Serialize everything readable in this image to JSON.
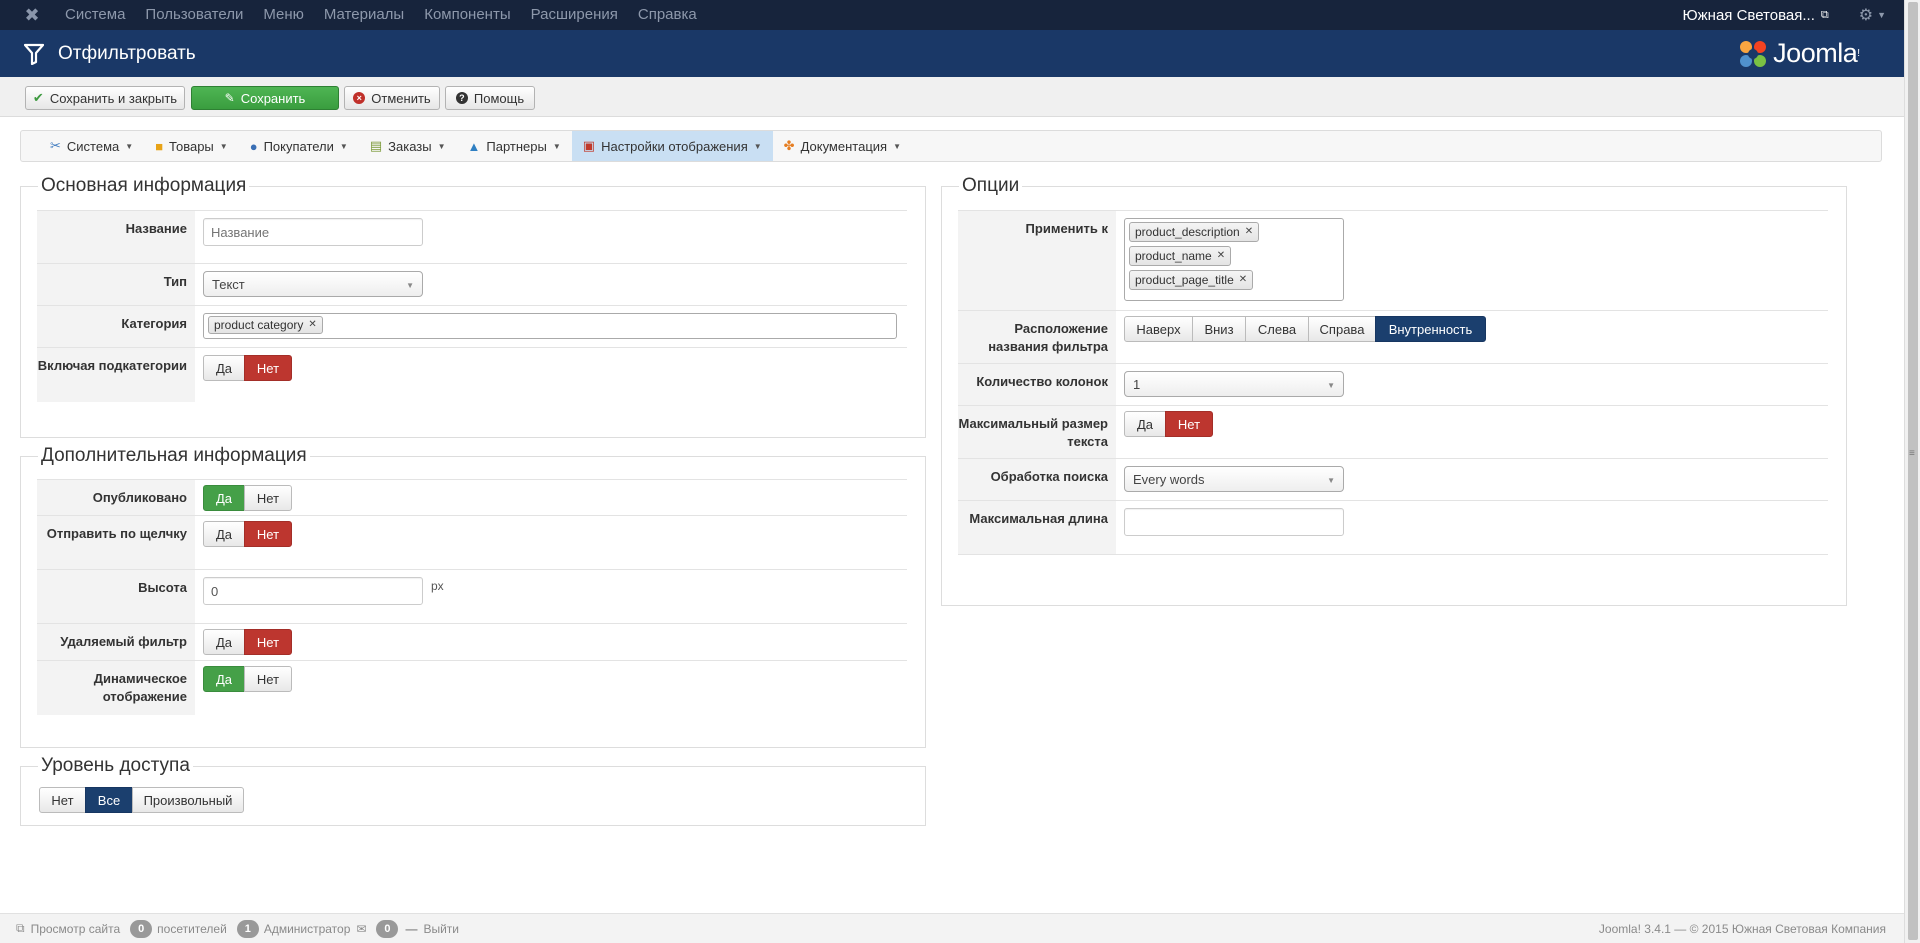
{
  "navbar": {
    "menu": [
      "Система",
      "Пользователи",
      "Меню",
      "Материалы",
      "Компоненты",
      "Расширения",
      "Справка"
    ],
    "site_name": "Южная Световая...",
    "logo_icon": "joomla-x-icon"
  },
  "header": {
    "title": "Отфильтровать",
    "brand": "Joomla!",
    "brand_word": "Joomla",
    "brand_mark": "!"
  },
  "toolbar": {
    "save_close": "Сохранить и закрыть",
    "save": "Сохранить",
    "cancel": "Отменить",
    "help": "Помощь"
  },
  "submenu": {
    "items": [
      {
        "label": "Система",
        "icon": "tools-icon"
      },
      {
        "label": "Товары",
        "icon": "box-icon"
      },
      {
        "label": "Покупатели",
        "icon": "users-icon"
      },
      {
        "label": "Заказы",
        "icon": "orders-icon"
      },
      {
        "label": "Партнеры",
        "icon": "partners-icon"
      },
      {
        "label": "Настройки отображения",
        "icon": "display-icon",
        "active": true
      },
      {
        "label": "Документация",
        "icon": "docs-icon"
      }
    ]
  },
  "basic": {
    "legend": "Основная информация",
    "name_label": "Название",
    "name_placeholder": "Название",
    "type_label": "Тип",
    "type_value": "Текст",
    "category_label": "Категория",
    "category_chip": "product category",
    "subcats_label": "Включая подкатегории",
    "yes": "Да",
    "no": "Нет"
  },
  "extra": {
    "legend": "Дополнительная информация",
    "published_label": "Опубликовано",
    "click_label": "Отправить по щелчку",
    "height_label": "Высота",
    "height_value": "0",
    "height_unit": "px",
    "removable_label": "Удаляемый фильтр",
    "dynamic_label": "Динамическое отображение",
    "yes": "Да",
    "no": "Нет"
  },
  "access": {
    "legend": "Уровень доступа",
    "options": [
      "Нет",
      "Все",
      "Произвольный"
    ],
    "selected": "Все"
  },
  "options": {
    "legend": "Опции",
    "apply_label": "Применить к",
    "apply_chips": [
      "product_description",
      "product_name",
      "product_page_title"
    ],
    "position_label": "Расположение названия фильтра",
    "position_options": [
      "Наверх",
      "Вниз",
      "Слева",
      "Справа",
      "Внутренность"
    ],
    "position_selected": "Внутренность",
    "columns_label": "Количество колонок",
    "columns_value": "1",
    "maxsize_label": "Максимальный размер текста",
    "search_label": "Обработка поиска",
    "search_value": "Every words",
    "maxlen_label": "Максимальная длина",
    "maxlen_value": "",
    "yes": "Да",
    "no": "Нет"
  },
  "footer": {
    "view_site": "Просмотр сайта",
    "visitors_count": "0",
    "visitors_label": "посетителей",
    "admins_count": "1",
    "admins_label": "Администратор",
    "messages_count": "0",
    "logout": "Выйти",
    "copyright": "Joomla! 3.4.1 — © 2015 Южная Световая Компания"
  },
  "colors": {
    "navbar": "#17243c",
    "header": "#1a3867",
    "green": "#45a048",
    "red": "#bd362f",
    "blue": "#1b3f6e",
    "submenu_active": "#c9dff3"
  }
}
